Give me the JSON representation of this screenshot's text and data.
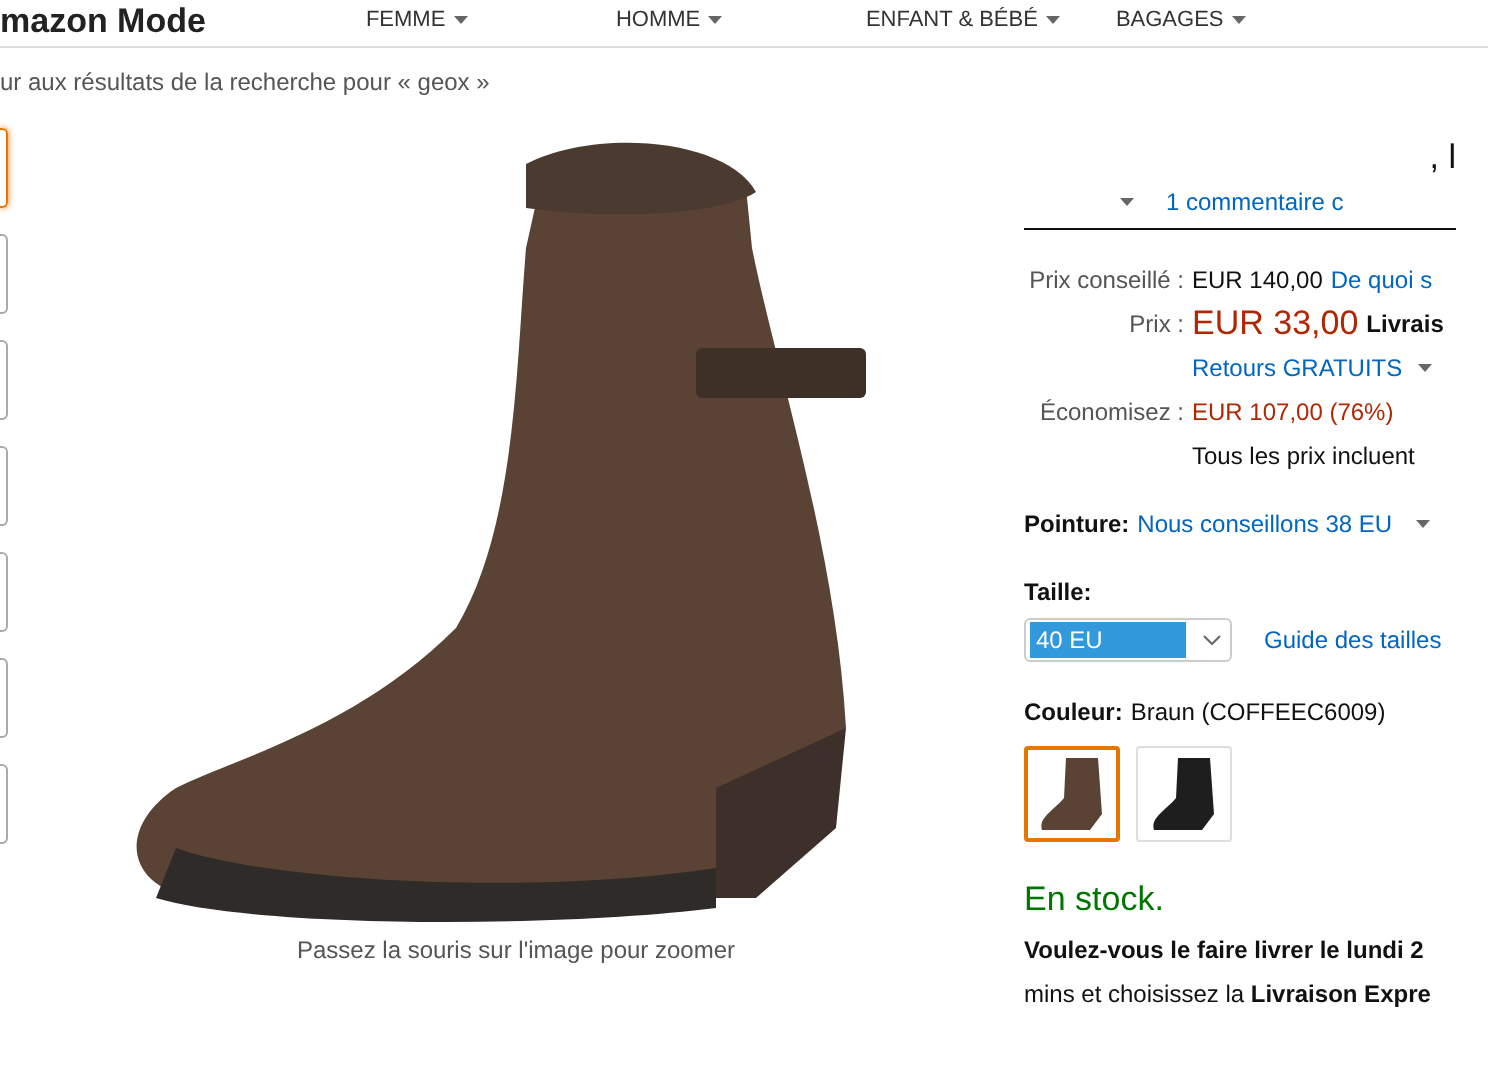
{
  "header": {
    "logo": "mazon Mode",
    "nav": [
      {
        "label": "FEMME"
      },
      {
        "label": "HOMME"
      },
      {
        "label": "ENFANT & BÉBÉ"
      },
      {
        "label": "BAGAGES"
      }
    ]
  },
  "breadcrumb": "ur aux résultats de la recherche pour « geox »",
  "thumbnails": [
    {
      "selected": true
    },
    {
      "selected": false
    },
    {
      "selected": false
    },
    {
      "selected": false
    },
    {
      "selected": false
    },
    {
      "selected": false
    },
    {
      "selected": false
    }
  ],
  "image_caption": "Passez la souris sur l'image pour zoomer",
  "product": {
    "title": ", l",
    "reviews": "1 commentaire c",
    "prices": [
      {
        "label": "Prix conseillé :",
        "value": "EUR 140,00",
        "extra": "De quoi s",
        "kind": "list"
      },
      {
        "label": "Prix :",
        "value": "EUR 33,00",
        "extra": "Livrais",
        "kind": "price"
      },
      {
        "value": "Retours GRATUITS",
        "kind": "returns"
      },
      {
        "label": "Économisez :",
        "value": "EUR 107,00 (76%)",
        "kind": "savings"
      },
      {
        "value": "Tous les prix incluent",
        "kind": "note"
      }
    ],
    "pointure_label": "Pointure:",
    "pointure_value": "Nous conseillons 38 EU",
    "size_label": "Taille:",
    "size_value": "40 EU",
    "size_guide": "Guide des tailles",
    "color_label": "Couleur:",
    "color_value": "Braun (COFFEEC6009)",
    "swatches": [
      {
        "selected": true,
        "color": "#5a4334"
      },
      {
        "selected": false,
        "color": "#1e1e1e"
      }
    ],
    "stock": "En stock.",
    "delivery": "**Voulez-vous le faire livrer le lundi 2**",
    "delivery2": "mins et choisissez la **Livraison Expre**"
  }
}
